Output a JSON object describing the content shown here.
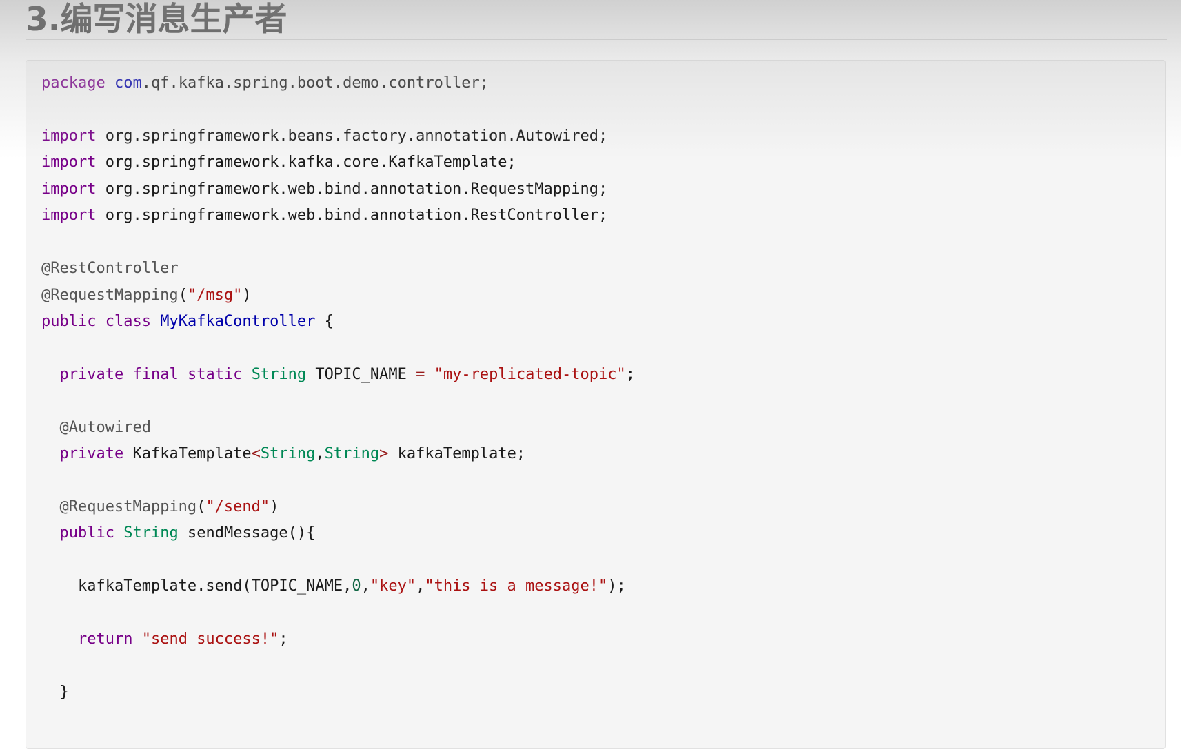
{
  "heading": "3.编写消息生产者",
  "code": {
    "package_kw": "package",
    "package_root": "com",
    "package_rest": ".qf.kafka.spring.boot.demo.controller;",
    "import_kw": "import",
    "imports": [
      "org.springframework.beans.factory.annotation.Autowired;",
      "org.springframework.kafka.core.KafkaTemplate;",
      "org.springframework.web.bind.annotation.RequestMapping;",
      "org.springframework.web.bind.annotation.RestController;"
    ],
    "ann_rest_controller": "@RestController",
    "ann_request_mapping": "@RequestMapping",
    "open_paren": "(",
    "close_paren": ")",
    "msg_path": "\"/msg\"",
    "public_kw": "public",
    "class_kw": "class",
    "class_name": "MyKafkaController",
    "open_brace": "{",
    "close_brace": "}",
    "private_kw": "private",
    "final_kw": "final",
    "static_kw": "static",
    "string_type": "String",
    "topic_const": "TOPIC_NAME",
    "assign_op": "=",
    "topic_value": "\"my-replicated-topic\"",
    "semicolon": ";",
    "ann_autowired": "@Autowired",
    "kafka_template_type": "KafkaTemplate",
    "lt": "<",
    "gt": ">",
    "comma": ",",
    "kafka_template_field": "kafkaTemplate;",
    "send_path": "\"/send\"",
    "method_name": "sendMessage",
    "method_suffix": "(){",
    "send_call": "kafkaTemplate.send(TOPIC_NAME,",
    "partition": "0",
    "key_arg": "\"key\"",
    "message_arg": "\"this is a message!\"",
    "call_end": ");",
    "return_kw": "return",
    "return_value": "\"send success!\""
  }
}
